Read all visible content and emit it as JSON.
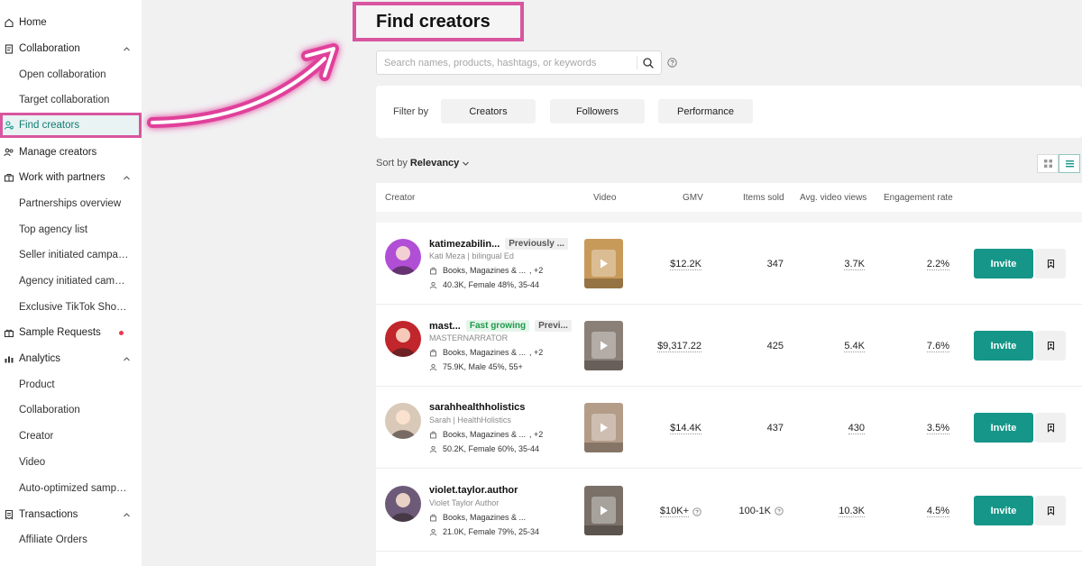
{
  "sidebar": {
    "items": [
      {
        "label": "Home",
        "icon": "home-icon",
        "type": "top"
      },
      {
        "label": "Collaboration",
        "icon": "clipboard-icon",
        "type": "section",
        "expanded": true
      },
      {
        "label": "Open collaboration",
        "type": "sub"
      },
      {
        "label": "Target collaboration",
        "type": "sub"
      },
      {
        "label": "Find creators",
        "icon": "person-search-icon",
        "type": "active"
      },
      {
        "label": "Manage creators",
        "icon": "people-icon",
        "type": "top"
      },
      {
        "label": "Work with partners",
        "icon": "handshake-icon",
        "type": "section",
        "expanded": true
      },
      {
        "label": "Partnerships overview",
        "type": "sub"
      },
      {
        "label": "Top agency list",
        "type": "sub"
      },
      {
        "label": "Seller initiated campaigns",
        "type": "sub"
      },
      {
        "label": "Agency initiated campaigns",
        "type": "sub"
      },
      {
        "label": "Exclusive TikTok Shop creators",
        "type": "sub"
      },
      {
        "label": "Sample Requests",
        "icon": "gift-icon",
        "type": "top",
        "notification": true
      },
      {
        "label": "Analytics",
        "icon": "bar-chart-icon",
        "type": "section",
        "expanded": true
      },
      {
        "label": "Product",
        "type": "sub"
      },
      {
        "label": "Collaboration",
        "type": "sub"
      },
      {
        "label": "Creator",
        "type": "sub"
      },
      {
        "label": "Video",
        "type": "sub"
      },
      {
        "label": "Auto-optimized samples",
        "type": "sub"
      },
      {
        "label": "Transactions",
        "icon": "receipt-icon",
        "type": "section",
        "expanded": true
      },
      {
        "label": "Affiliate Orders",
        "type": "sub"
      }
    ]
  },
  "page": {
    "title": "Find creators"
  },
  "search": {
    "placeholder": "Search names, products, hashtags, or keywords",
    "value": ""
  },
  "filter": {
    "label": "Filter by",
    "buttons": [
      "Creators",
      "Followers",
      "Performance"
    ]
  },
  "sort": {
    "prefix": "Sort by",
    "value": "Relevancy"
  },
  "table": {
    "columns": [
      "Creator",
      "Video",
      "GMV",
      "Items sold",
      "Avg. video views",
      "Engagement rate"
    ],
    "rows": [
      {
        "name": "katimezabilin...",
        "badges": [
          {
            "text": "Previously ...",
            "kind": "prev"
          }
        ],
        "handle": "Kati Meza | bilingual Ed",
        "categories": "Books, Magazines & ...",
        "categories_extra": ", +2",
        "audience": "40.3K, Female 48%, 35-44",
        "gmv": "$12.2K",
        "items_sold": "347",
        "avg_views": "3.7K",
        "engagement": "2.2%",
        "invite_label": "Invite",
        "avatar_color": "#b04fd6",
        "thumb_color": "#c89a5a"
      },
      {
        "name": "mast...",
        "badges": [
          {
            "text": "Fast growing",
            "kind": "fast"
          },
          {
            "text": "Previ...",
            "kind": "prev"
          }
        ],
        "handle": "MASTERNARRATOR",
        "categories": "Books, Magazines & ...",
        "categories_extra": ", +2",
        "audience": "75.9K, Male 45%, 55+",
        "gmv": "$9,317.22",
        "items_sold": "425",
        "avg_views": "5.4K",
        "engagement": "7.6%",
        "invite_label": "Invite",
        "avatar_color": "#c0262b",
        "thumb_color": "#8a8078"
      },
      {
        "name": "sarahhealthholistics",
        "badges": [],
        "handle": "Sarah | HealthHolistics",
        "categories": "Books, Magazines & ...",
        "categories_extra": ", +2",
        "audience": "50.2K, Female 60%, 35-44",
        "gmv": "$14.4K",
        "items_sold": "437",
        "avg_views": "430",
        "engagement": "3.5%",
        "invite_label": "Invite",
        "avatar_color": "#d9c9b8",
        "thumb_color": "#b39c88"
      },
      {
        "name": "violet.taylor.author",
        "badges": [],
        "handle": "Violet Taylor Author",
        "categories": "Books, Magazines & ...",
        "categories_extra": "",
        "audience": "21.0K, Female 79%, 25-34",
        "gmv": "$10K+",
        "items_sold": "100-1K",
        "avg_views": "10.3K",
        "engagement": "4.5%",
        "invite_label": "Invite",
        "avatar_color": "#6d5a78",
        "thumb_color": "#7a7068",
        "gmv_info": true,
        "items_info": true
      }
    ]
  },
  "colors": {
    "accent": "#159688",
    "highlight": "#d8569f",
    "active_text": "#137b74"
  }
}
